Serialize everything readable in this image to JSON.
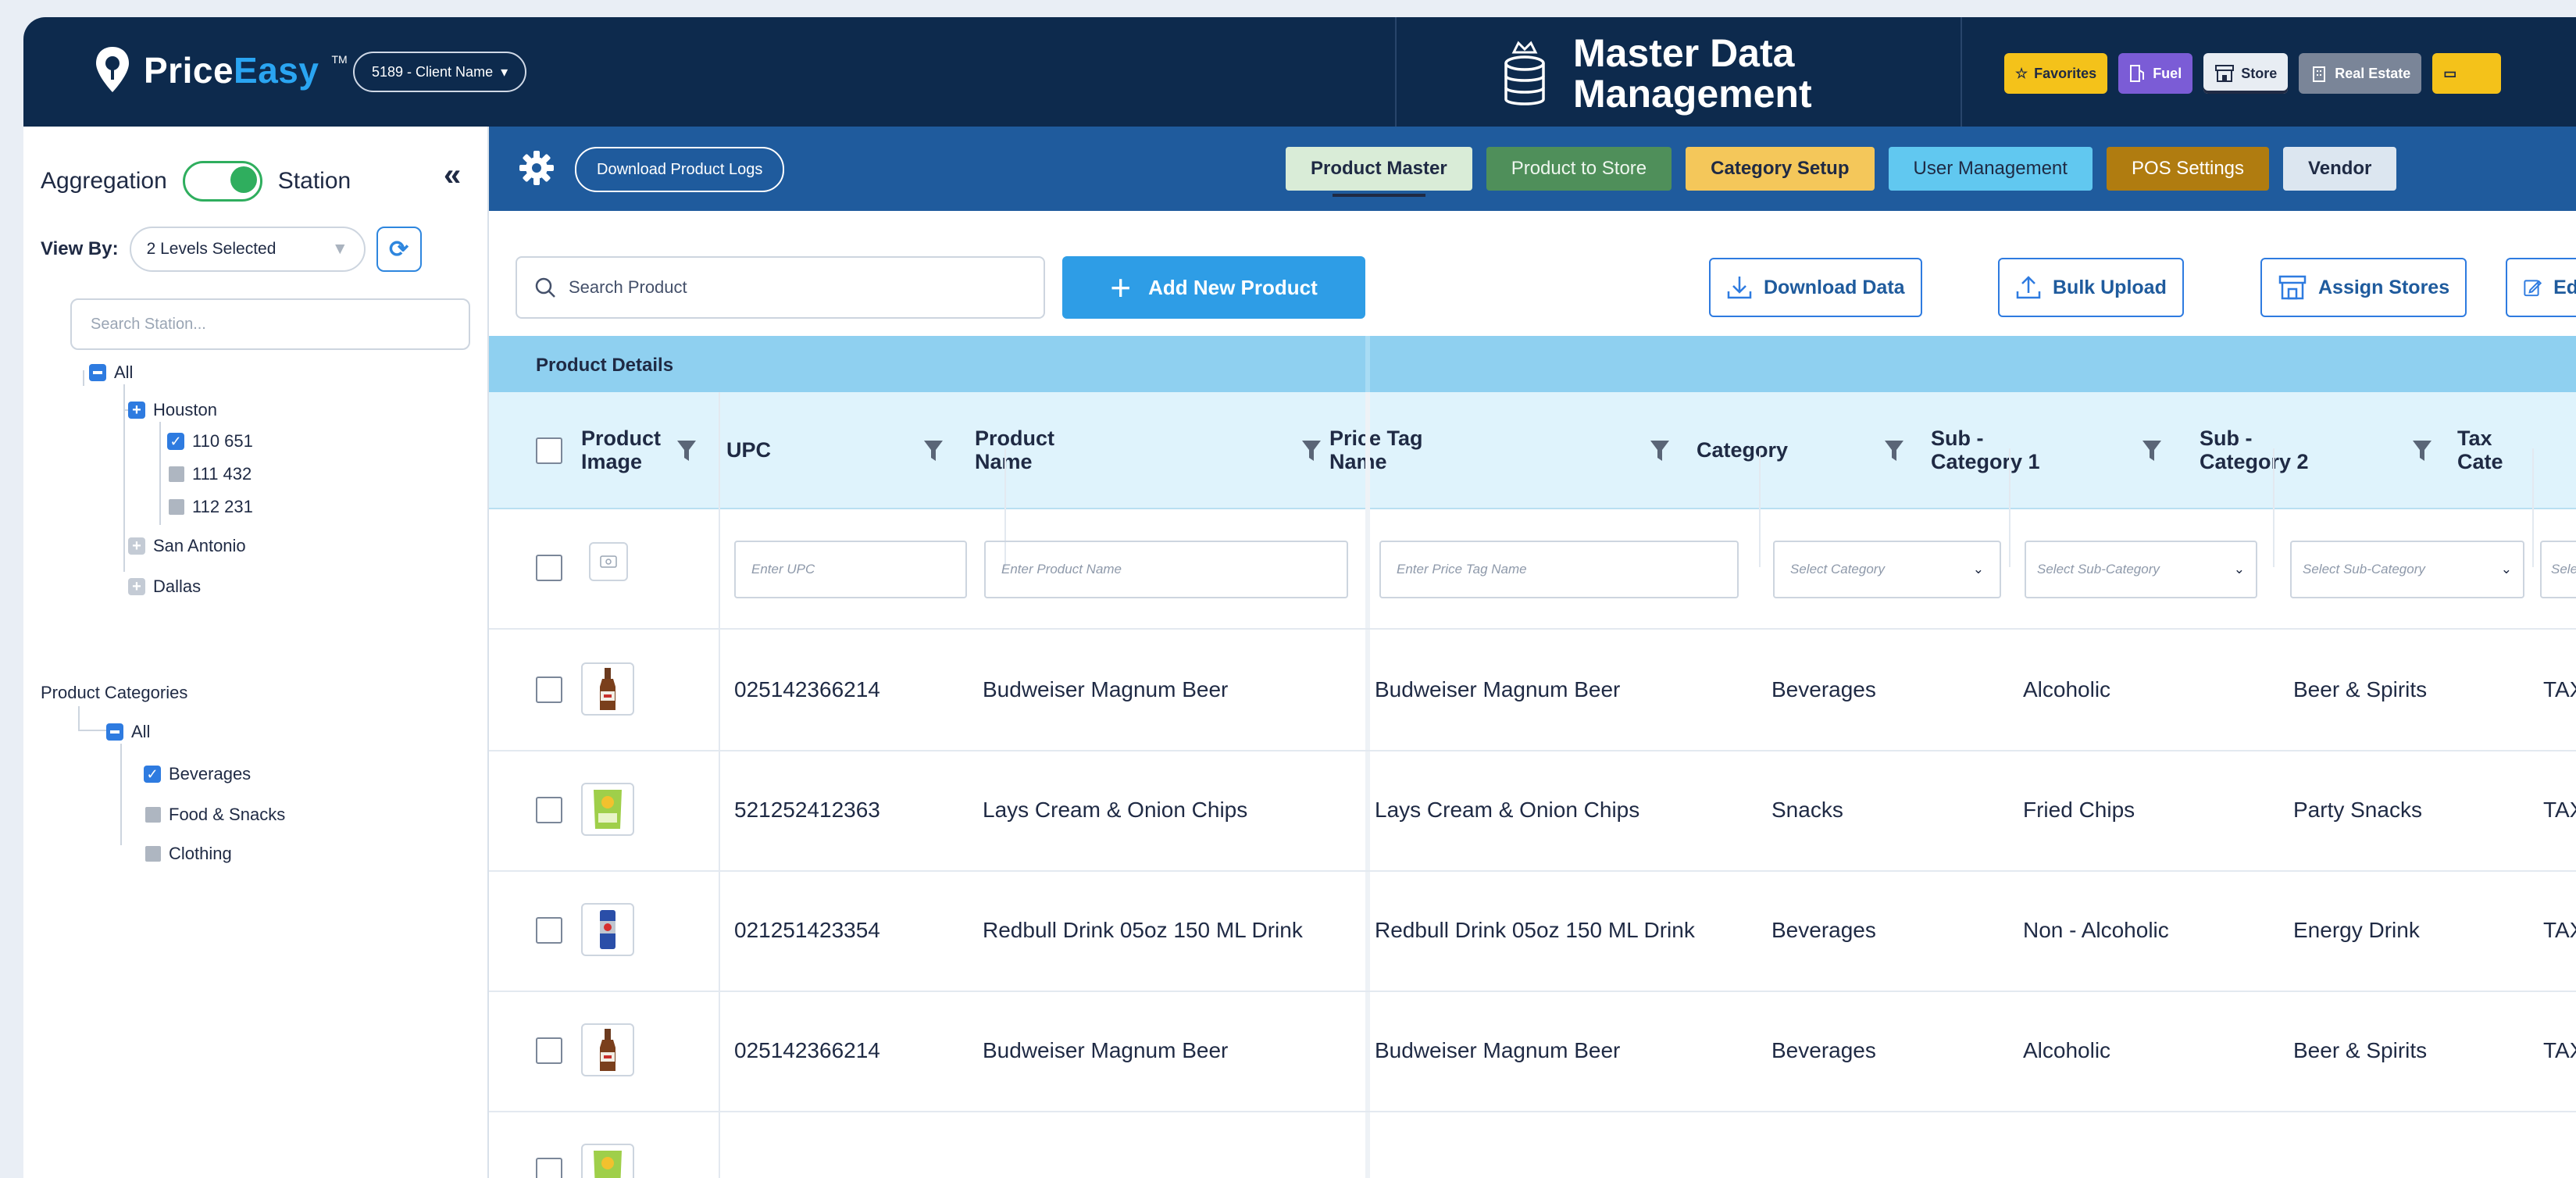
{
  "app": {
    "brand_main": "Price",
    "brand_accent": "Easy",
    "brand_tm": "TM",
    "client": "5189 - Client Name",
    "module_title_1": "Master Data",
    "module_title_2": "Management"
  },
  "shortcuts": [
    {
      "label": "Favorites",
      "icon": "star-icon"
    },
    {
      "label": "Fuel",
      "icon": "fuel-pump-icon"
    },
    {
      "label": "Store",
      "icon": "store-icon"
    },
    {
      "label": "Real Estate",
      "icon": "building-icon"
    },
    {
      "label": "",
      "icon": "more-icon"
    }
  ],
  "sidebar": {
    "aggregation_label": "Aggregation",
    "station_label": "Station",
    "collapse_glyph": "«",
    "view_by_label": "View By:",
    "view_by_value": "2 Levels Selected",
    "search_placeholder": "Search Station...",
    "tree_all": "All",
    "houston": "Houston",
    "station_1": "110 651",
    "station_2": "111 432",
    "station_3": "112 231",
    "san_antonio": "San Antonio",
    "dallas": "Dallas",
    "categories_title": "Product Categories",
    "cat_all": "All",
    "cat_1": "Beverages",
    "cat_2": "Food & Snacks",
    "cat_3": "Clothing"
  },
  "subnav": {
    "download_logs": "Download Product Logs",
    "tabs": [
      "Product Master",
      "Product to Store",
      "Category Setup",
      "User Management",
      "POS Settings",
      "Vendor"
    ]
  },
  "toolbar": {
    "search_placeholder": "Search Product",
    "add_product": "Add New Product",
    "download_data": "Download Data",
    "bulk_upload": "Bulk Upload",
    "assign_stores": "Assign Stores",
    "edit": "Edi"
  },
  "table": {
    "group_label": "Product Details",
    "columns": [
      "Product\nImage",
      "UPC",
      "Product\nName",
      "Price Tag\nName",
      "Category",
      "Sub -\nCategory 1",
      "Sub -\nCategory 2",
      "Tax\nCate"
    ],
    "filters": {
      "upc": "Enter UPC",
      "product_name": "Enter Product Name",
      "price_tag": "Enter Price Tag Name",
      "category": "Select Category",
      "sub1": "Select Sub-Category",
      "sub2": "Select Sub-Category",
      "tax": "Selec"
    },
    "rows": [
      {
        "upc": "025142366214",
        "name": "Budweiser Magnum Beer",
        "tag": "Budweiser Magnum Beer",
        "category": "Beverages",
        "sub1": "Alcoholic",
        "sub2": "Beer & Spirits",
        "tax": "TAX_"
      },
      {
        "upc": "521252412363",
        "name": "Lays Cream & Onion Chips",
        "tag": "Lays Cream & Onion Chips",
        "category": "Snacks",
        "sub1": "Fried Chips",
        "sub2": "Party Snacks",
        "tax": "TAX_"
      },
      {
        "upc": "021251423354",
        "name": "Redbull Drink 05oz 150 ML Drink",
        "tag": "Redbull Drink 05oz 150 ML Drink",
        "category": "Beverages",
        "sub1": "Non - Alcoholic",
        "sub2": "Energy Drink",
        "tax": "TAX_"
      },
      {
        "upc": "025142366214",
        "name": "Budweiser Magnum Beer",
        "tag": "Budweiser Magnum Beer",
        "category": "Beverages",
        "sub1": "Alcoholic",
        "sub2": "Beer & Spirits",
        "tax": "TAX_"
      }
    ]
  },
  "colors": {
    "topbar": "#0d2a4d",
    "subnav": "#1f5b9d",
    "accent": "#2e9de6",
    "toggle_on": "#2fae5e"
  }
}
